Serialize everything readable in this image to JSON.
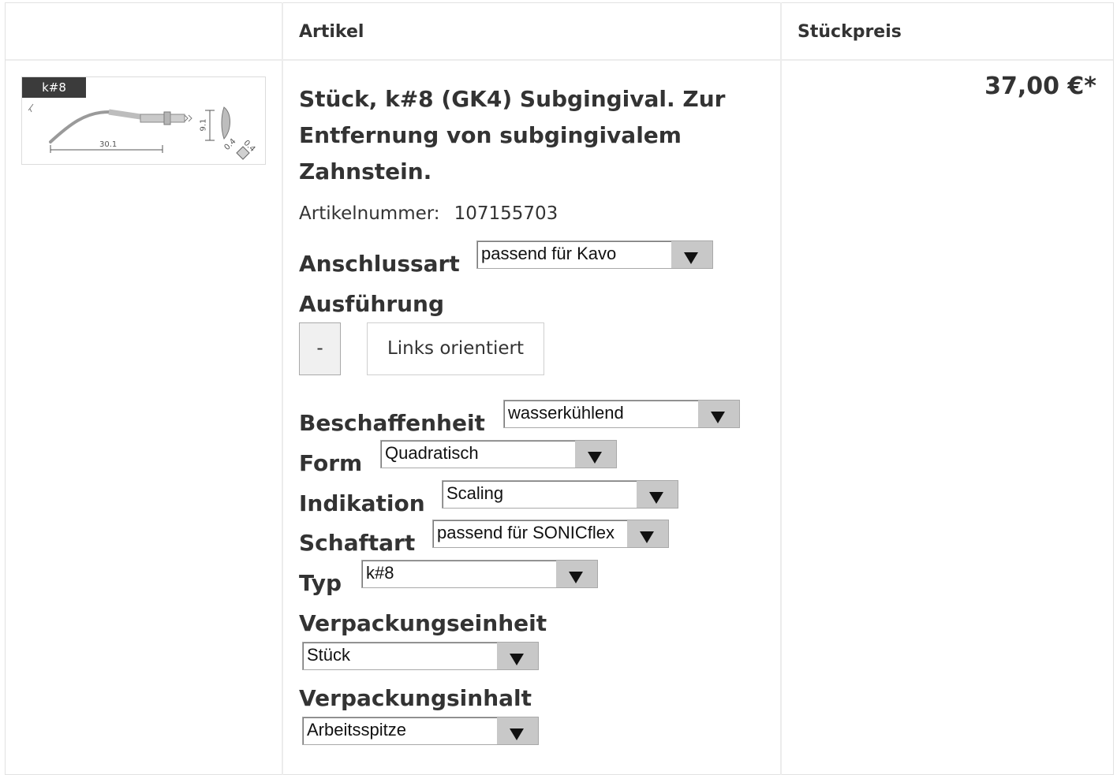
{
  "table": {
    "headers": {
      "image": "",
      "article": "Artikel",
      "unit_price": "Stückpreis"
    }
  },
  "product": {
    "image_tag": "k#8",
    "image_dims": {
      "length": "30.1",
      "height": "9.1",
      "tip_a": "0.4",
      "tip_b": "0.4"
    },
    "title": "Stück, k#8 (GK4) Subgingival. Zur Entfernung von subgingivalem Zahnstein.",
    "article_number_label": "Artikelnummer:",
    "article_number": "107155703",
    "price": "37,00 €*"
  },
  "options": {
    "anschlussart": {
      "label": "Anschlussart",
      "value": "passend für Kavo"
    },
    "ausfuehrung": {
      "label": "Ausführung",
      "buttons": [
        {
          "label": "-",
          "selected": true
        },
        {
          "label": "Links orientiert",
          "selected": false
        }
      ]
    },
    "beschaffenheit": {
      "label": "Beschaffenheit",
      "value": "wasserkühlend"
    },
    "form": {
      "label": "Form",
      "value": "Quadratisch"
    },
    "indikation": {
      "label": "Indikation",
      "value": "Scaling"
    },
    "schaftart": {
      "label": "Schaftart",
      "value": "passend für SONICflex"
    },
    "typ": {
      "label": "Typ",
      "value": "k#8"
    },
    "verpackungseinheit": {
      "label": "Verpackungseinheit",
      "value": "Stück"
    },
    "verpackungsinhalt": {
      "label": "Verpackungsinhalt",
      "value": "Arbeitsspitze"
    }
  },
  "icons": {
    "dropdown": "triangle-down-icon"
  },
  "colors": {
    "text": "#333333",
    "border": "#e2e2e2",
    "select_arrow_bg": "#c8c8c8"
  }
}
